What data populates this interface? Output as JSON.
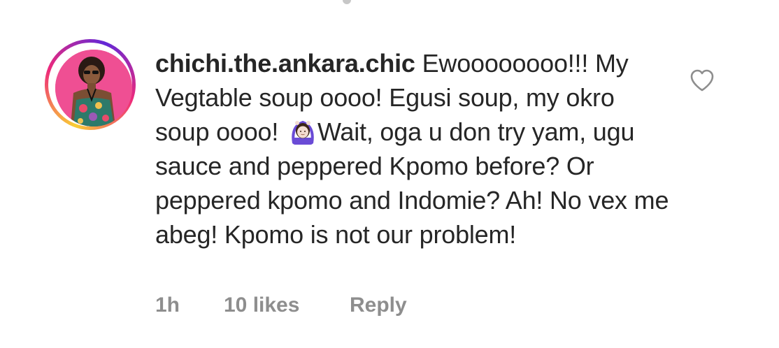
{
  "comment": {
    "username": "chichi.the.ankara.chic",
    "text_part1": "Ewoooooooo!!! My Vegtable soup oooo! Egusi soup, my okro soup oooo!",
    "emoji": "woman-gesturing-ok-icon",
    "text_part2": "Wait, oga u don try yam, ugu sauce and peppered Kpomo before? Or peppered kpomo and Indomie? Ah! No vex me abeg! Kpomo is not our problem!",
    "time": "1h",
    "likes": "10 likes",
    "reply_label": "Reply",
    "like_icon": "heart-outline-icon"
  },
  "colors": {
    "text": "#262626",
    "meta": "#8e8e8e",
    "avatar_bg": "#ef4f93",
    "story_ring": [
      "#f9ce34",
      "#ee2a7b",
      "#6228d7"
    ]
  }
}
